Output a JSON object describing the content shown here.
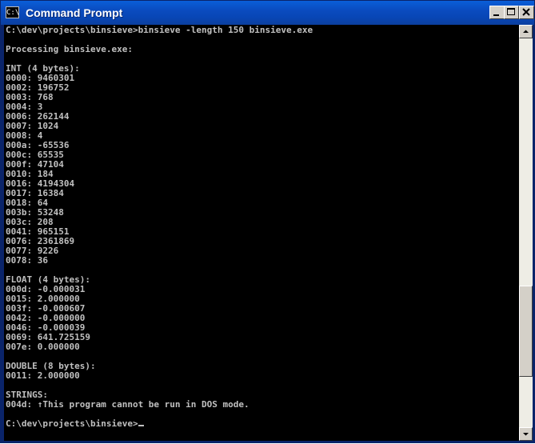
{
  "window": {
    "title": "Command Prompt",
    "icon_label": "C:\\"
  },
  "console": {
    "command_line": "C:\\dev\\projects\\binsieve>binsieve -length 150 binsieve.exe",
    "processing": "Processing binsieve.exe:",
    "int_header": "INT (4 bytes):",
    "int_lines": [
      "0000: 9460301",
      "0002: 196752",
      "0003: 768",
      "0004: 3",
      "0006: 262144",
      "0007: 1024",
      "0008: 4",
      "000a: -65536",
      "000c: 65535",
      "000f: 47104",
      "0010: 184",
      "0016: 4194304",
      "0017: 16384",
      "0018: 64",
      "003b: 53248",
      "003c: 208",
      "0041: 965151",
      "0076: 2361869",
      "0077: 9226",
      "0078: 36"
    ],
    "float_header": "FLOAT (4 bytes):",
    "float_lines": [
      "000d: -0.000031",
      "0015: 2.000000",
      "003f: -0.000607",
      "0042: -0.000000",
      "0046: -0.000039",
      "0069: 641.725159",
      "007e: 0.000000"
    ],
    "double_header": "DOUBLE (8 bytes):",
    "double_lines": [
      "0011: 2.000000"
    ],
    "strings_header": "STRINGS:",
    "strings_lines": [
      "004d: ↑This program cannot be run in DOS mode."
    ],
    "prompt": "C:\\dev\\projects\\binsieve>"
  },
  "scrollbar": {
    "position_fraction": 0.83
  },
  "colors": {
    "titlebar": "#0a4bbf",
    "console_bg": "#000000",
    "console_text": "#c0c0c0"
  }
}
